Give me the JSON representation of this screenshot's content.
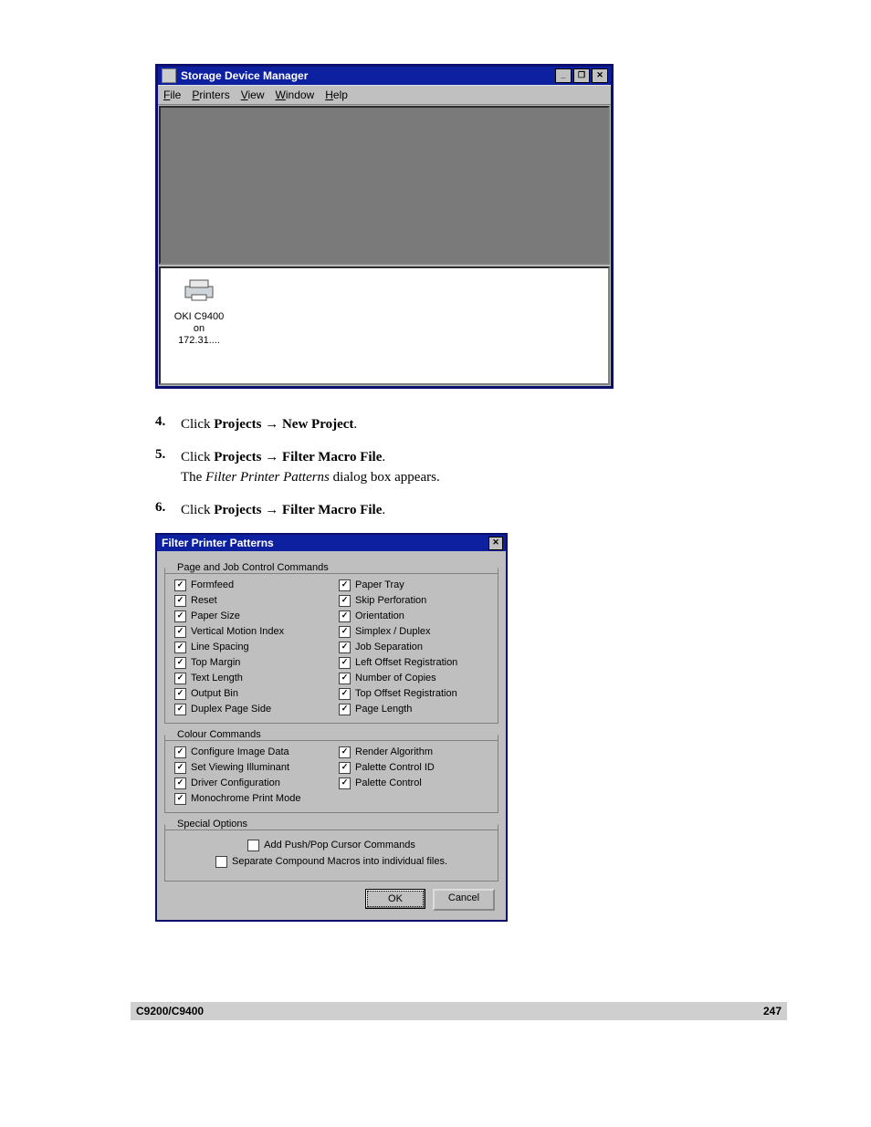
{
  "win1": {
    "title": "Storage Device Manager",
    "menu": [
      "File",
      "Printers",
      "View",
      "Window",
      "Help"
    ],
    "menu_mnemonic_pos": [
      0,
      0,
      0,
      0,
      0
    ],
    "printer_line1": "OKI C9400",
    "printer_line2": "on 172.31....",
    "btn_min": "_",
    "btn_max": "❐",
    "btn_close": "✕"
  },
  "steps": {
    "s4": {
      "num": "4.",
      "prefix": "Click ",
      "b1": "Projects ",
      "arrow": "→",
      "b2": " New Project",
      "after": "."
    },
    "s5": {
      "num": "5.",
      "prefix": "Click ",
      "b1": "Projects ",
      "arrow": "→",
      "b2": " Filter Macro File",
      "after2": ".",
      "line2_prefix": "The ",
      "line2_i": "Filter Printer Patterns",
      "line2_after": " dialog box appears."
    },
    "s6": {
      "num": "6.",
      "prefix": "Click ",
      "b1": "Projects ",
      "arrow": "→",
      "b2": " Filter Macro File",
      "after": "."
    }
  },
  "dlg": {
    "title": "Filter Printer Patterns",
    "close": "✕",
    "group1": "Page and Job Control Commands",
    "group2": "Colour Commands",
    "group3": "Special Options",
    "col1": [
      "Formfeed",
      "Reset",
      "Paper Size",
      "Vertical Motion Index",
      "Line Spacing",
      "Top Margin",
      "Text Length",
      "Output Bin",
      "Duplex Page Side"
    ],
    "col2": [
      "Paper Tray",
      "Skip Perforation",
      "Orientation",
      "Simplex / Duplex",
      "Job Separation",
      "Left Offset Registration",
      "Number of Copies",
      "Top Offset Registration",
      "Page Length"
    ],
    "colour_left": [
      "Configure Image Data",
      "Set Viewing Illuminant",
      "Driver Configuration",
      "Monochrome Print Mode"
    ],
    "colour_right": [
      "Render Algorithm",
      "Palette Control ID",
      "Palette Control"
    ],
    "special": [
      "Add Push/Pop Cursor Commands",
      "Separate Compound Macros into individual files."
    ],
    "ok": "OK",
    "cancel": "Cancel"
  },
  "footer": {
    "left": "C9200/C9400",
    "page": "247"
  }
}
